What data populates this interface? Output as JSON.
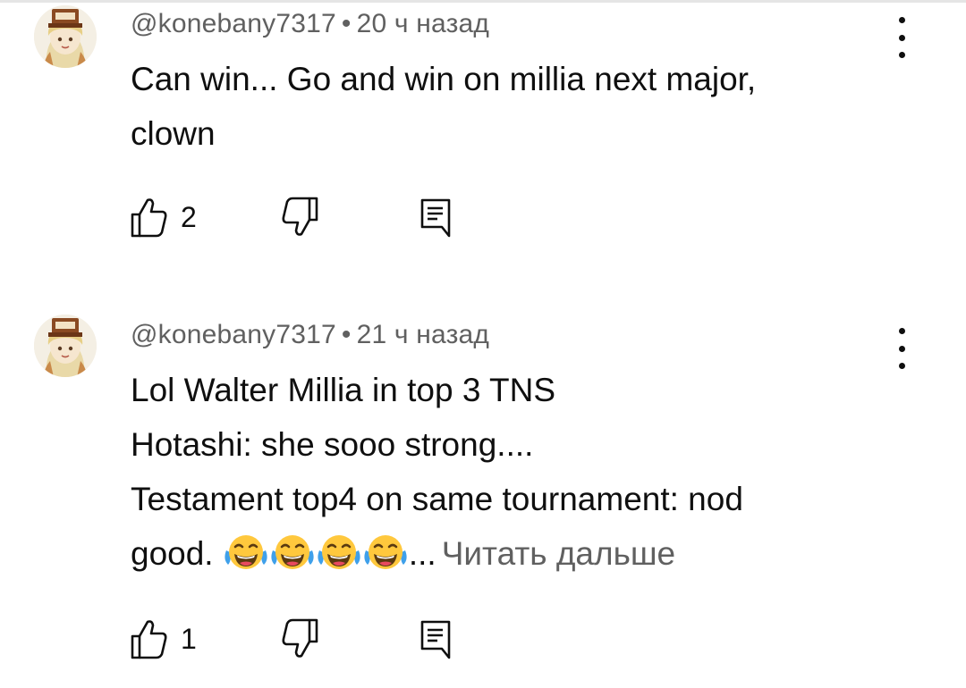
{
  "comments": [
    {
      "author": "@konebany7317",
      "separator": "•",
      "time": "20 ч назад",
      "lines": [
        "Can win... Go and win on millia next major,",
        "clown"
      ],
      "likes": "2",
      "avatar_icon": "anime-character-avatar",
      "menu_icon": "more-vert-icon"
    },
    {
      "author": "@konebany7317",
      "separator": "•",
      "time": "21 ч назад",
      "lines": [
        "Lol Walter Millia in top 3 TNS",
        "Hotashi: she sooo strong....",
        "Testament top4 on same tournament: nod"
      ],
      "last_line_text": "good.",
      "emojis": [
        "😂",
        "😂",
        "😂",
        "😂"
      ],
      "ellipsis": "...",
      "read_more": "Читать дальше",
      "likes": "1",
      "avatar_icon": "anime-character-avatar",
      "menu_icon": "more-vert-icon"
    }
  ],
  "colors": {
    "text_primary": "#0f0f0f",
    "text_secondary": "#606060",
    "emoji_face": "#ffc83d"
  }
}
